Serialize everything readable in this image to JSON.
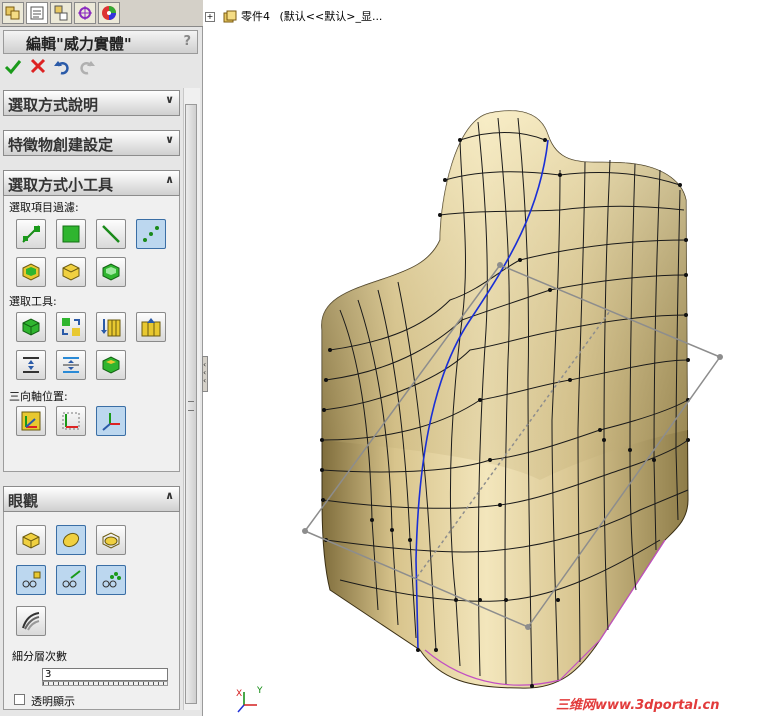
{
  "property_manager": {
    "title": "編輯\"威力實體\"",
    "help": "?"
  },
  "groups": {
    "selection_help": {
      "label": "選取方式說明"
    },
    "feature_settings": {
      "label": "特徵物創建設定"
    },
    "selection_tools": {
      "label": "選取方式小工具",
      "filter_label": "選取項目過濾:",
      "tools_label": "選取工具:",
      "triad_label": "三向軸位置:"
    },
    "display": {
      "label": "眼觀",
      "subdivision_label": "細分層次數",
      "subdivision_value": "3",
      "transparency_label": "透明顯示"
    }
  },
  "tree": {
    "label": "零件4",
    "config": "(默认<<默认>_显..."
  },
  "triad": {
    "x": "X",
    "y": "Y"
  },
  "watermark": "三维网www.3dportal.cn",
  "colors": {
    "accent": "#3a6ea5",
    "model_surface": "#e6d6a0",
    "watermark": "#e23b3b"
  }
}
